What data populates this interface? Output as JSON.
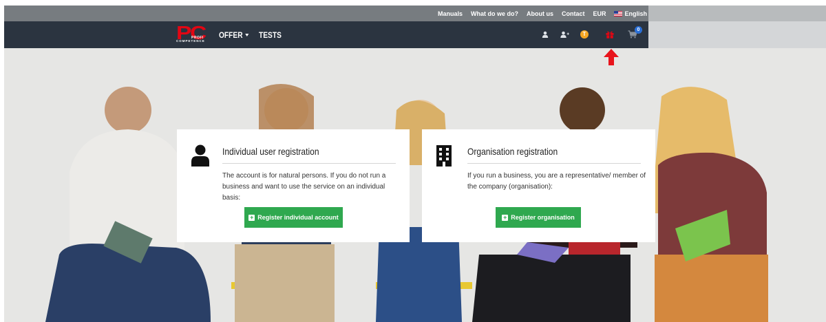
{
  "topbar": {
    "links": [
      "Manuals",
      "What do we do?",
      "About us",
      "Contact",
      "EUR"
    ],
    "language": "English"
  },
  "logo": {
    "brand": "PC",
    "profi": "PROFI",
    "sub": "COMPETENCE"
  },
  "nav": {
    "offer": "OFFER",
    "tests": "TESTS",
    "cart_count": "0",
    "coin_label": "T"
  },
  "individual": {
    "title": "Individual user registration",
    "text": "The account is for natural persons. If you do not run a business and want to use the service on an individual basis:",
    "button": "Register individual account"
  },
  "organisation": {
    "title": "Organisation registration",
    "text": "If you run a business, you are a representative/ member of the company (organisation):",
    "button": "Register organisation"
  },
  "colors": {
    "accent": "#2fa84f",
    "brand": "#e30613",
    "navbar": "#2b3440",
    "badge": "#2a6fd6",
    "coin": "#f5a623"
  }
}
